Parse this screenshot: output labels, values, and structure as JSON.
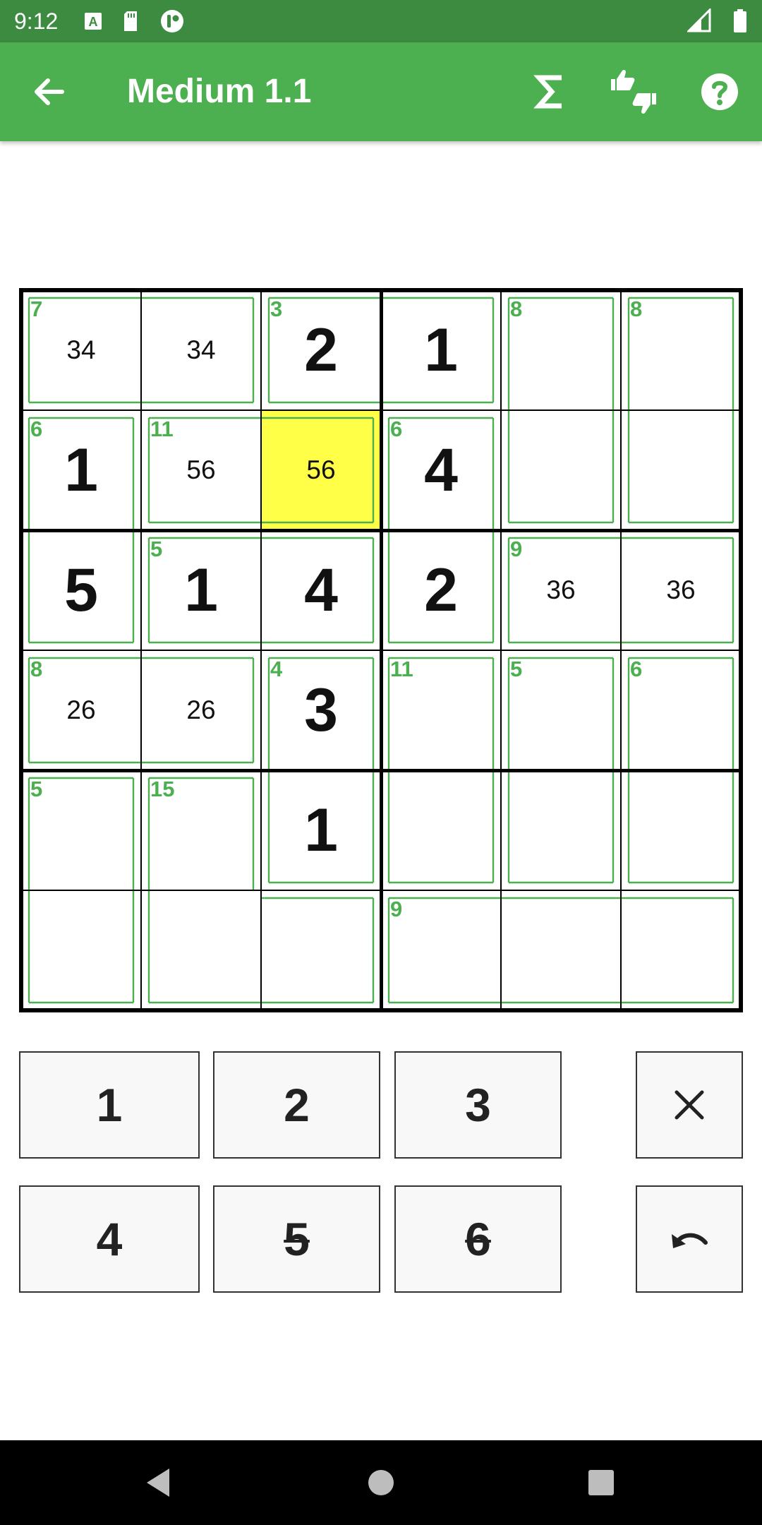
{
  "status_bar": {
    "time": "9:12",
    "icons_left": [
      "a-notification-icon",
      "sd-card-icon",
      "app-notification-icon"
    ],
    "icons_right": [
      "signal-icon",
      "battery-icon"
    ]
  },
  "app_bar": {
    "title": "Medium 1.1",
    "back_icon": "arrow-back-icon",
    "actions": [
      "sigma-icon",
      "thumbs-up-down-icon",
      "help-icon"
    ]
  },
  "colors": {
    "app_bar": "#4caf50",
    "status_bar": "#3d8b40",
    "cage": "#4caf50",
    "highlight": "#ffff48"
  },
  "board": {
    "size": 6,
    "selected": [
      1,
      2
    ],
    "cells": [
      [
        {
          "value": "",
          "notes": "34"
        },
        {
          "value": "",
          "notes": "34"
        },
        {
          "value": "2",
          "notes": ""
        },
        {
          "value": "1",
          "notes": ""
        },
        {
          "value": "",
          "notes": ""
        },
        {
          "value": "",
          "notes": ""
        }
      ],
      [
        {
          "value": "1",
          "notes": ""
        },
        {
          "value": "",
          "notes": "56"
        },
        {
          "value": "",
          "notes": "56"
        },
        {
          "value": "4",
          "notes": ""
        },
        {
          "value": "",
          "notes": ""
        },
        {
          "value": "",
          "notes": ""
        }
      ],
      [
        {
          "value": "5",
          "notes": ""
        },
        {
          "value": "1",
          "notes": ""
        },
        {
          "value": "4",
          "notes": ""
        },
        {
          "value": "2",
          "notes": ""
        },
        {
          "value": "",
          "notes": "36"
        },
        {
          "value": "",
          "notes": "36"
        }
      ],
      [
        {
          "value": "",
          "notes": "26"
        },
        {
          "value": "",
          "notes": "26"
        },
        {
          "value": "3",
          "notes": ""
        },
        {
          "value": "",
          "notes": ""
        },
        {
          "value": "",
          "notes": ""
        },
        {
          "value": "",
          "notes": ""
        }
      ],
      [
        {
          "value": "",
          "notes": ""
        },
        {
          "value": "",
          "notes": ""
        },
        {
          "value": "1",
          "notes": ""
        },
        {
          "value": "",
          "notes": ""
        },
        {
          "value": "",
          "notes": ""
        },
        {
          "value": "",
          "notes": ""
        }
      ],
      [
        {
          "value": "",
          "notes": ""
        },
        {
          "value": "",
          "notes": ""
        },
        {
          "value": "",
          "notes": ""
        },
        {
          "value": "",
          "notes": ""
        },
        {
          "value": "",
          "notes": ""
        },
        {
          "value": "",
          "notes": ""
        }
      ]
    ],
    "cages": [
      {
        "sum": "7",
        "cells": [
          [
            0,
            0
          ],
          [
            0,
            1
          ]
        ]
      },
      {
        "sum": "3",
        "cells": [
          [
            0,
            2
          ],
          [
            0,
            3
          ]
        ]
      },
      {
        "sum": "8",
        "cells": [
          [
            0,
            4
          ],
          [
            1,
            4
          ]
        ]
      },
      {
        "sum": "8",
        "cells": [
          [
            0,
            5
          ],
          [
            1,
            5
          ]
        ]
      },
      {
        "sum": "6",
        "cells": [
          [
            1,
            0
          ],
          [
            2,
            0
          ]
        ]
      },
      {
        "sum": "11",
        "cells": [
          [
            1,
            1
          ],
          [
            1,
            2
          ]
        ]
      },
      {
        "sum": "6",
        "cells": [
          [
            1,
            3
          ],
          [
            2,
            3
          ]
        ]
      },
      {
        "sum": "5",
        "cells": [
          [
            2,
            1
          ],
          [
            2,
            2
          ]
        ]
      },
      {
        "sum": "9",
        "cells": [
          [
            2,
            4
          ],
          [
            2,
            5
          ]
        ]
      },
      {
        "sum": "8",
        "cells": [
          [
            3,
            0
          ],
          [
            3,
            1
          ]
        ]
      },
      {
        "sum": "4",
        "cells": [
          [
            3,
            2
          ],
          [
            4,
            2
          ]
        ]
      },
      {
        "sum": "11",
        "cells": [
          [
            3,
            3
          ],
          [
            4,
            3
          ]
        ]
      },
      {
        "sum": "5",
        "cells": [
          [
            3,
            4
          ],
          [
            4,
            4
          ]
        ]
      },
      {
        "sum": "6",
        "cells": [
          [
            3,
            5
          ],
          [
            4,
            5
          ]
        ]
      },
      {
        "sum": "5",
        "cells": [
          [
            4,
            0
          ],
          [
            5,
            0
          ]
        ]
      },
      {
        "sum": "15",
        "cells": [
          [
            4,
            1
          ],
          [
            5,
            1
          ],
          [
            5,
            2
          ]
        ]
      },
      {
        "sum": "9",
        "cells": [
          [
            5,
            3
          ],
          [
            5,
            4
          ],
          [
            5,
            5
          ]
        ]
      }
    ]
  },
  "keypad": {
    "digits": [
      {
        "label": "1",
        "used": false
      },
      {
        "label": "2",
        "used": false
      },
      {
        "label": "3",
        "used": false
      },
      {
        "label": "4",
        "used": false
      },
      {
        "label": "5",
        "used": true
      },
      {
        "label": "6",
        "used": true
      }
    ],
    "clear_icon": "close-icon",
    "undo_icon": "undo-icon"
  },
  "nav_bar": {
    "buttons": [
      "back-triangle-icon",
      "home-circle-icon",
      "recents-square-icon"
    ]
  }
}
